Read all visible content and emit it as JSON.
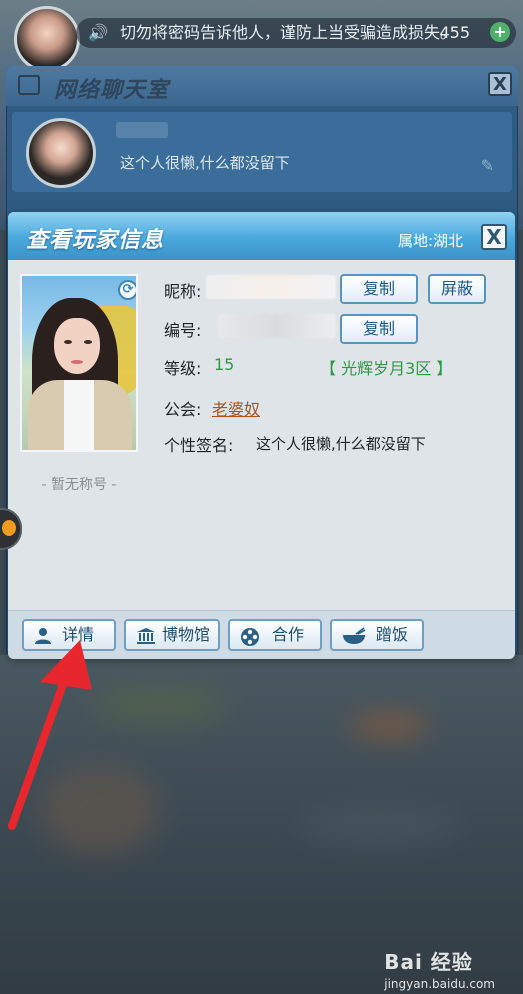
{
  "notice_bar": {
    "text": "切勿将密码告诉他人，谨防上当受骗造成损失。",
    "count": "455",
    "plus": "+"
  },
  "chat_room": {
    "title": "网络聊天室",
    "close": "X",
    "my_signature": "这个人很懒,什么都没留下"
  },
  "player_dialog": {
    "title": "查看玩家信息",
    "location": "属地:湖北",
    "close": "X",
    "no_title": "- 暂无称号 -",
    "fields": {
      "nickname_label": "昵称:",
      "id_label": "编号:",
      "level_label": "等级:",
      "level_value": "15",
      "server": "【 光辉岁月3区 】",
      "guild_label": "公会:",
      "guild_value": "老婆奴",
      "signature_label": "个性签名:",
      "signature_value": "这个人很懒,什么都没留下"
    },
    "buttons": {
      "copy_nickname": "复制",
      "block": "屏蔽",
      "copy_id": "复制"
    },
    "footer": [
      {
        "label": "详情",
        "icon": "user-icon"
      },
      {
        "label": "博物馆",
        "icon": "museum-icon"
      },
      {
        "label": "合作",
        "icon": "film-reel-icon"
      },
      {
        "label": "蹭饭",
        "icon": "rice-bowl-icon"
      }
    ]
  },
  "watermark": {
    "brand": "Bai 经验",
    "url": "jingyan.baidu.com"
  },
  "colors": {
    "dialog_header": "#4aa8dc",
    "level_green": "#2f9a45",
    "guild_link": "#a4561f",
    "arrow_red": "#e8262d"
  }
}
